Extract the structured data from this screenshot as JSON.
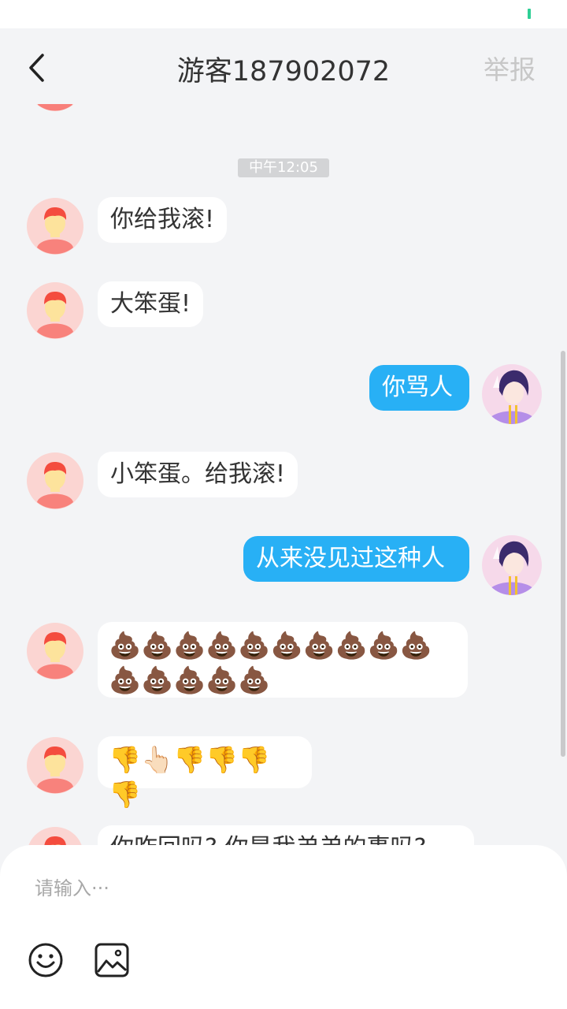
{
  "header": {
    "title": "游客187902072",
    "report_label": "举报"
  },
  "chat": {
    "timestamp": "中午12:05",
    "messages": [
      {
        "side": "left",
        "text": "你给我滚!"
      },
      {
        "side": "left",
        "text": "大笨蛋!"
      },
      {
        "side": "right",
        "text": "你骂人"
      },
      {
        "side": "left",
        "text": "小笨蛋。给我滚!"
      },
      {
        "side": "right",
        "text": "从来没见过这种人"
      },
      {
        "side": "left",
        "text": "💩💩💩💩💩💩💩💩💩💩💩💩💩💩💩"
      },
      {
        "side": "left",
        "text": "👎👆🏻👎👎👎👎"
      },
      {
        "side": "left",
        "text": "你咋回吗? 你是我弟弟的事吗?"
      }
    ]
  },
  "input": {
    "placeholder": "请输入···",
    "value": ""
  },
  "icons": {
    "back": "chevron-left-icon",
    "emoji": "smiley-icon",
    "image": "image-icon"
  },
  "colors": {
    "outgoing_bubble": "#28b0f5",
    "incoming_bubble": "#ffffff",
    "background": "#f3f4f6",
    "report_text": "#c7c7c7"
  }
}
